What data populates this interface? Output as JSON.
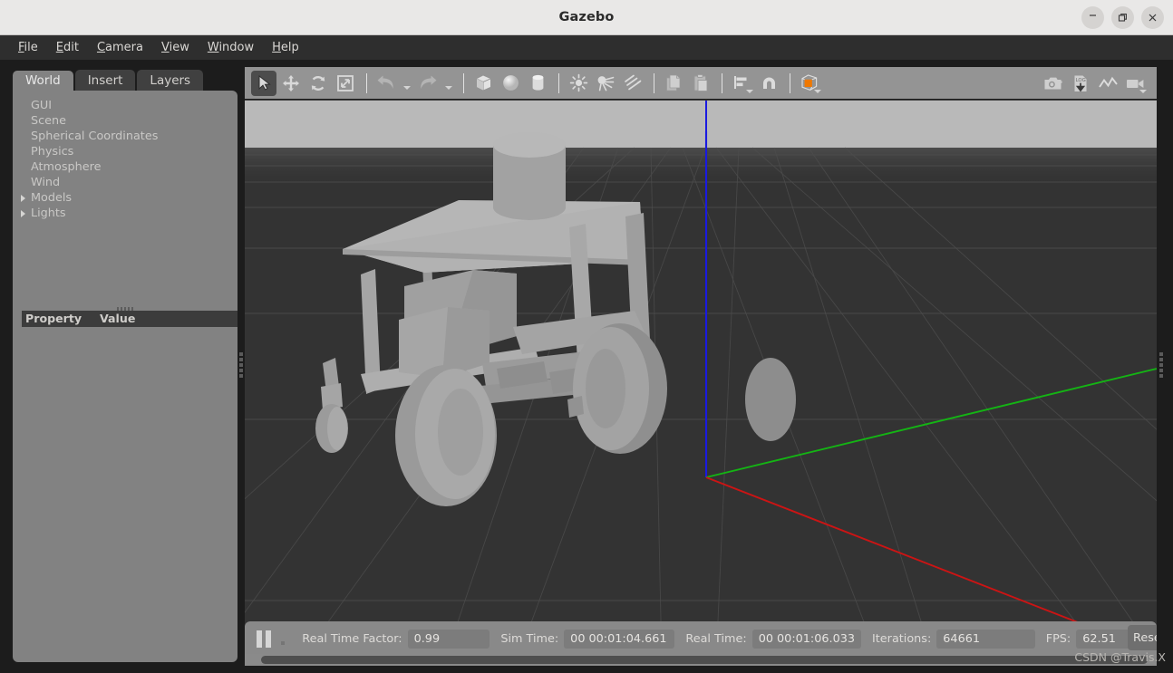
{
  "window": {
    "title": "Gazebo",
    "minimize_label": "–",
    "maximize_label": "❐",
    "close_label": "✕"
  },
  "menubar": {
    "items": [
      {
        "label": "File",
        "mnemonic": "F"
      },
      {
        "label": "Edit",
        "mnemonic": "E"
      },
      {
        "label": "Camera",
        "mnemonic": "C"
      },
      {
        "label": "View",
        "mnemonic": "V"
      },
      {
        "label": "Window",
        "mnemonic": "W"
      },
      {
        "label": "Help",
        "mnemonic": "H"
      }
    ]
  },
  "left_panel": {
    "tabs": [
      {
        "label": "World",
        "active": true
      },
      {
        "label": "Insert",
        "active": false
      },
      {
        "label": "Layers",
        "active": false
      }
    ],
    "tree": [
      {
        "label": "GUI",
        "expandable": false
      },
      {
        "label": "Scene",
        "expandable": false
      },
      {
        "label": "Spherical Coordinates",
        "expandable": false
      },
      {
        "label": "Physics",
        "expandable": false
      },
      {
        "label": "Atmosphere",
        "expandable": false
      },
      {
        "label": "Wind",
        "expandable": false
      },
      {
        "label": "Models",
        "expandable": true
      },
      {
        "label": "Lights",
        "expandable": true
      }
    ],
    "property_table": {
      "columns": [
        "Property",
        "Value"
      ],
      "rows": []
    }
  },
  "toolbar": {
    "left_tools": [
      {
        "name": "select-mode",
        "icon": "cursor-arrow-icon",
        "active": true
      },
      {
        "name": "translate-mode",
        "icon": "move-icon",
        "active": false
      },
      {
        "name": "rotate-mode",
        "icon": "rotate-icon",
        "active": false
      },
      {
        "name": "scale-mode",
        "icon": "scale-icon",
        "active": false
      },
      {
        "name": "separator-1",
        "icon": "separator",
        "active": false
      },
      {
        "name": "undo",
        "icon": "undo-arrow-icon",
        "active": false
      },
      {
        "name": "undo-menu",
        "icon": "chevron-down-icon",
        "active": false
      },
      {
        "name": "redo",
        "icon": "redo-arrow-icon",
        "active": false
      },
      {
        "name": "redo-menu",
        "icon": "chevron-down-icon",
        "active": false
      },
      {
        "name": "separator-2",
        "icon": "separator",
        "active": false
      },
      {
        "name": "insert-box",
        "icon": "box-icon",
        "active": false
      },
      {
        "name": "insert-sphere",
        "icon": "sphere-icon",
        "active": false
      },
      {
        "name": "insert-cylinder",
        "icon": "cylinder-icon",
        "active": false
      },
      {
        "name": "separator-3",
        "icon": "separator",
        "active": false
      },
      {
        "name": "point-light",
        "icon": "sun-icon",
        "active": false
      },
      {
        "name": "spot-light",
        "icon": "spotlight-icon",
        "active": false
      },
      {
        "name": "directional-light",
        "icon": "directional-light-icon",
        "active": false
      },
      {
        "name": "separator-4",
        "icon": "separator",
        "active": false
      },
      {
        "name": "copy",
        "icon": "copy-icon",
        "active": false
      },
      {
        "name": "paste",
        "icon": "paste-icon",
        "active": false
      },
      {
        "name": "separator-5",
        "icon": "separator",
        "active": false
      },
      {
        "name": "align",
        "icon": "align-icon",
        "active": false
      },
      {
        "name": "snap",
        "icon": "magnet-icon",
        "active": false
      },
      {
        "name": "separator-6",
        "icon": "separator",
        "active": false
      },
      {
        "name": "view-angle",
        "icon": "view-angle-cube-icon",
        "active": false
      }
    ],
    "right_tools": [
      {
        "name": "screenshot",
        "icon": "camera-icon"
      },
      {
        "name": "log-record",
        "icon": "log-download-icon"
      },
      {
        "name": "plot",
        "icon": "plot-line-icon"
      },
      {
        "name": "video-record",
        "icon": "video-camera-icon"
      }
    ],
    "accent_color": "#f07800"
  },
  "viewport": {
    "sky_color": "#b9b9b9",
    "ground_color": "#333333",
    "grid_color": "#4a4a4a",
    "model_color": "#a8a8a8",
    "axes": {
      "x_color": "#cc1414",
      "y_color": "#12bb12",
      "z_color": "#1414dd"
    }
  },
  "statusbar": {
    "pause_button": "pause-icon",
    "step_button": "step-icon",
    "fields": [
      {
        "label": "Real Time Factor:",
        "value": "0.99",
        "width": "w1"
      },
      {
        "label": "Sim Time:",
        "value": "00 00:01:04.661",
        "width": "w2"
      },
      {
        "label": "Real Time:",
        "value": "00 00:01:06.033",
        "width": "w3"
      },
      {
        "label": "Iterations:",
        "value": "64661",
        "width": "w4"
      },
      {
        "label": "FPS:",
        "value": "62.51",
        "width": "w5"
      }
    ],
    "reset_label": "Reset"
  },
  "watermark": {
    "text": "CSDN @Travis.X"
  }
}
